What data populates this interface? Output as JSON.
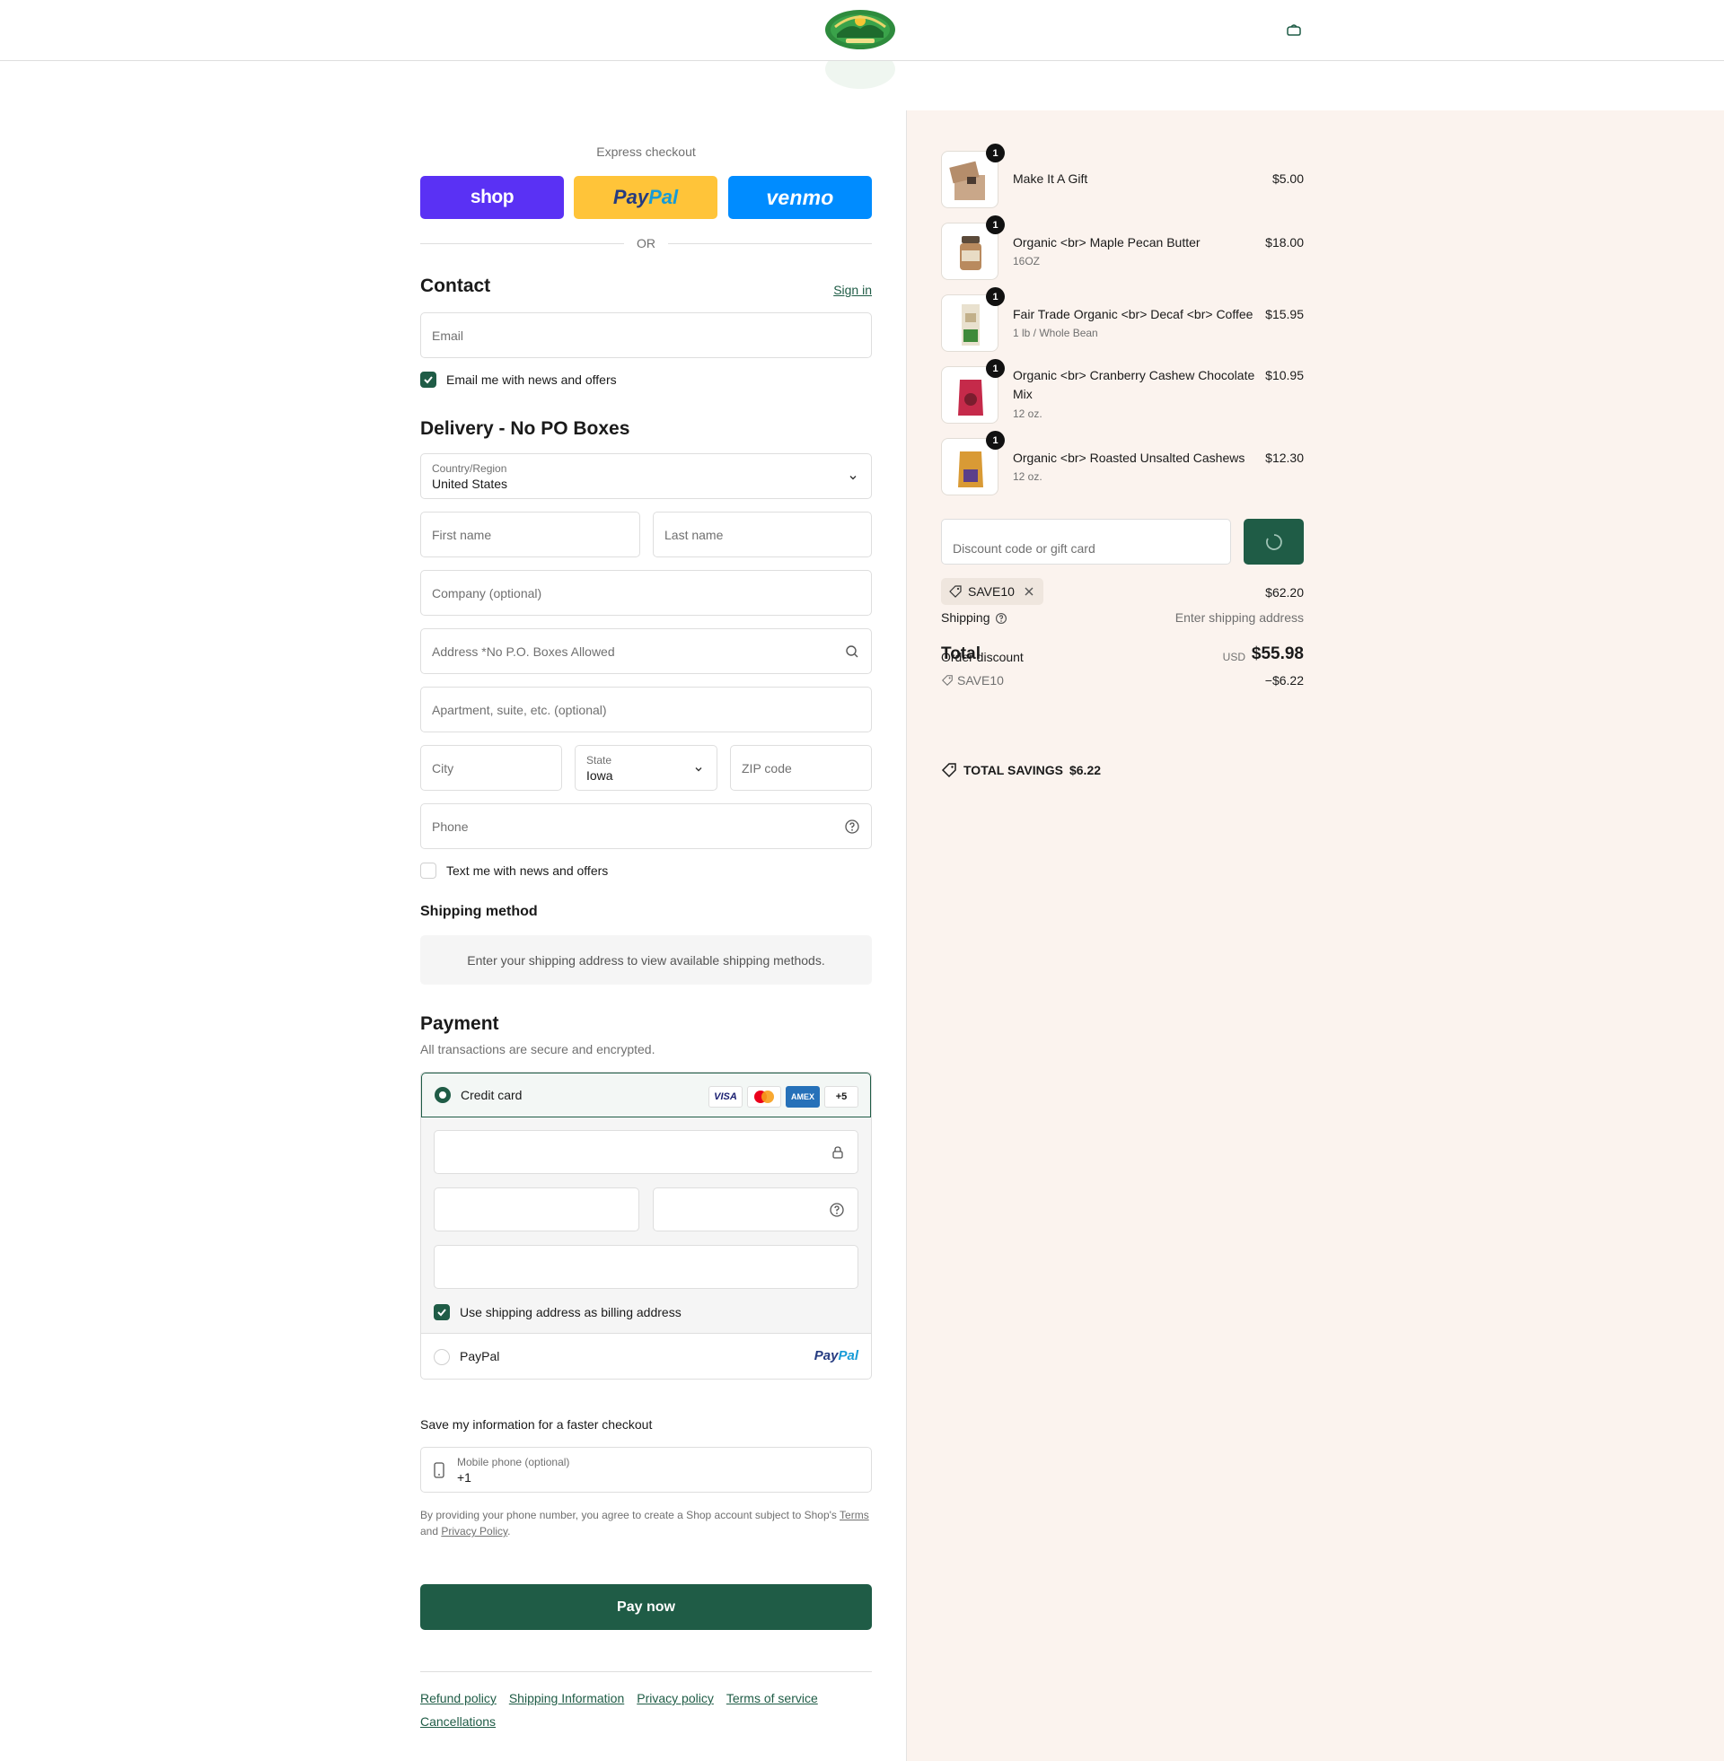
{
  "header": {
    "logo_alt": "Tierra Farm logo",
    "cart_icon": "bag-icon"
  },
  "express": {
    "title": "Express checkout",
    "shop_label": "shop",
    "paypal_label": "PayPal",
    "venmo_label": "venmo",
    "or": "OR"
  },
  "contact": {
    "title": "Contact",
    "sign_in": "Sign in",
    "email_placeholder": "Email",
    "news_label": "Email me with news and offers",
    "news_checked": true
  },
  "delivery": {
    "title": "Delivery - No PO Boxes",
    "country_label": "Country/Region",
    "country_value": "United States",
    "first_name": "First name",
    "last_name": "Last name",
    "company": "Company (optional)",
    "address": "Address *No P.O. Boxes Allowed",
    "apartment": "Apartment, suite, etc. (optional)",
    "city": "City",
    "state_label": "State",
    "state_value": "Iowa",
    "zip": "ZIP code",
    "phone": "Phone",
    "text_label": "Text me with news and offers",
    "text_checked": false
  },
  "shipping_method": {
    "title": "Shipping method",
    "message": "Enter your shipping address to view available shipping methods."
  },
  "payment": {
    "title": "Payment",
    "subtitle": "All transactions are secure and encrypted.",
    "credit_card_label": "Credit card",
    "card_logos": [
      "VISA",
      "Mastercard",
      "AMEX",
      "+5"
    ],
    "more_cards": "+5",
    "visa": "VISA",
    "amex": "AMEX",
    "billing_label": "Use shipping address as billing address",
    "billing_checked": true,
    "paypal_label": "PayPal",
    "paypal_logo": "PayPal"
  },
  "save_info": {
    "title": "Save my information for a faster checkout",
    "mobile_label": "Mobile phone (optional)",
    "mobile_value": "+1",
    "legal_prefix": "By providing your phone number, you agree to create a Shop account subject to Shop's",
    "terms": "Terms",
    "and": "and",
    "privacy": "Privacy Policy",
    "period": "."
  },
  "pay_now": "Pay now",
  "footer": {
    "links": [
      "Refund policy",
      "Shipping Information",
      "Privacy policy",
      "Terms of service",
      "Cancellations"
    ]
  },
  "summary": {
    "items": [
      {
        "qty": "1",
        "name": "Make It A Gift",
        "variant": "",
        "price": "$5.00"
      },
      {
        "qty": "1",
        "name": "Organic <br> Maple Pecan Butter",
        "variant": "16OZ",
        "price": "$18.00"
      },
      {
        "qty": "1",
        "name": "Fair Trade Organic <br> Decaf <br> Coffee",
        "variant": "1 lb / Whole Bean",
        "price": "$15.95"
      },
      {
        "qty": "1",
        "name": "Organic <br> Cranberry Cashew Chocolate Mix",
        "variant": "12 oz.",
        "price": "$10.95"
      },
      {
        "qty": "1",
        "name": "Organic <br> Roasted Unsalted Cashews",
        "variant": "12 oz.",
        "price": "$12.30"
      }
    ],
    "discount_placeholder": "Discount code or gift card",
    "applied_code": "SAVE10",
    "subtotal": "$62.20",
    "shipping_label": "Shipping",
    "shipping_value": "Enter shipping address",
    "total_label": "Total",
    "order_discount_label": "Order discount",
    "currency": "USD",
    "total": "$55.98",
    "discount_code": "SAVE10",
    "discount_amount": "−$6.22",
    "savings_label": "TOTAL SAVINGS",
    "savings_amount": "$6.22"
  },
  "colors": {
    "accent": "#1f5c46",
    "shop": "#5a31f4",
    "paypal": "#ffc439",
    "venmo": "#008cff",
    "summary_bg": "#fbf3ee"
  }
}
